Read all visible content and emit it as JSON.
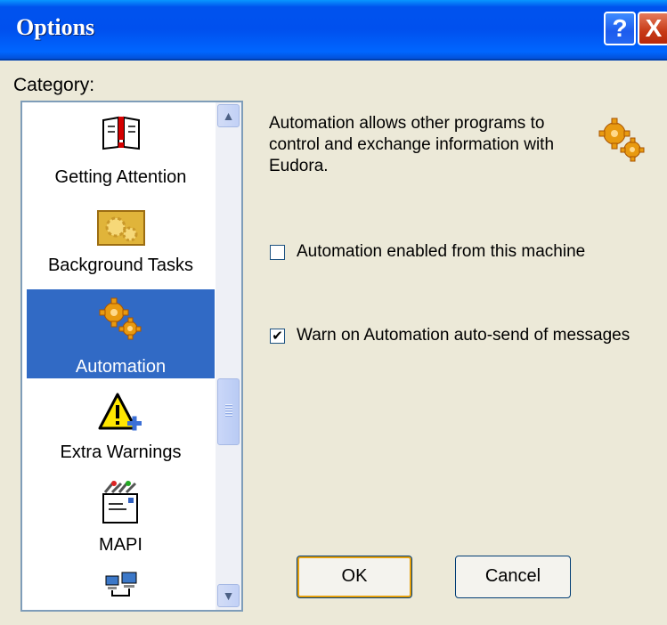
{
  "window": {
    "title": "Options",
    "help_label": "?",
    "close_label": "X"
  },
  "category": {
    "label": "Category:",
    "items": [
      {
        "label": "Getting Attention",
        "icon": "getting-attention-icon",
        "selected": false
      },
      {
        "label": "Background Tasks",
        "icon": "background-tasks-icon",
        "selected": false
      },
      {
        "label": "Automation",
        "icon": "automation-gears-icon",
        "selected": true
      },
      {
        "label": "Extra Warnings",
        "icon": "warning-plus-icon",
        "selected": false
      },
      {
        "label": "MAPI",
        "icon": "mapi-icon",
        "selected": false
      },
      {
        "label": "",
        "icon": "network-computers-icon",
        "selected": false
      }
    ]
  },
  "panel": {
    "description": "Automation allows other programs to control and exchange information with Eudora.",
    "checkboxes": [
      {
        "label": "Automation enabled from this machine",
        "checked": false
      },
      {
        "label": "Warn on Automation auto-send of messages",
        "checked": true
      }
    ]
  },
  "buttons": {
    "ok": "OK",
    "cancel": "Cancel"
  },
  "colors": {
    "titlebar": "#0055ea",
    "selection": "#316ac5",
    "face": "#ece9d8"
  }
}
